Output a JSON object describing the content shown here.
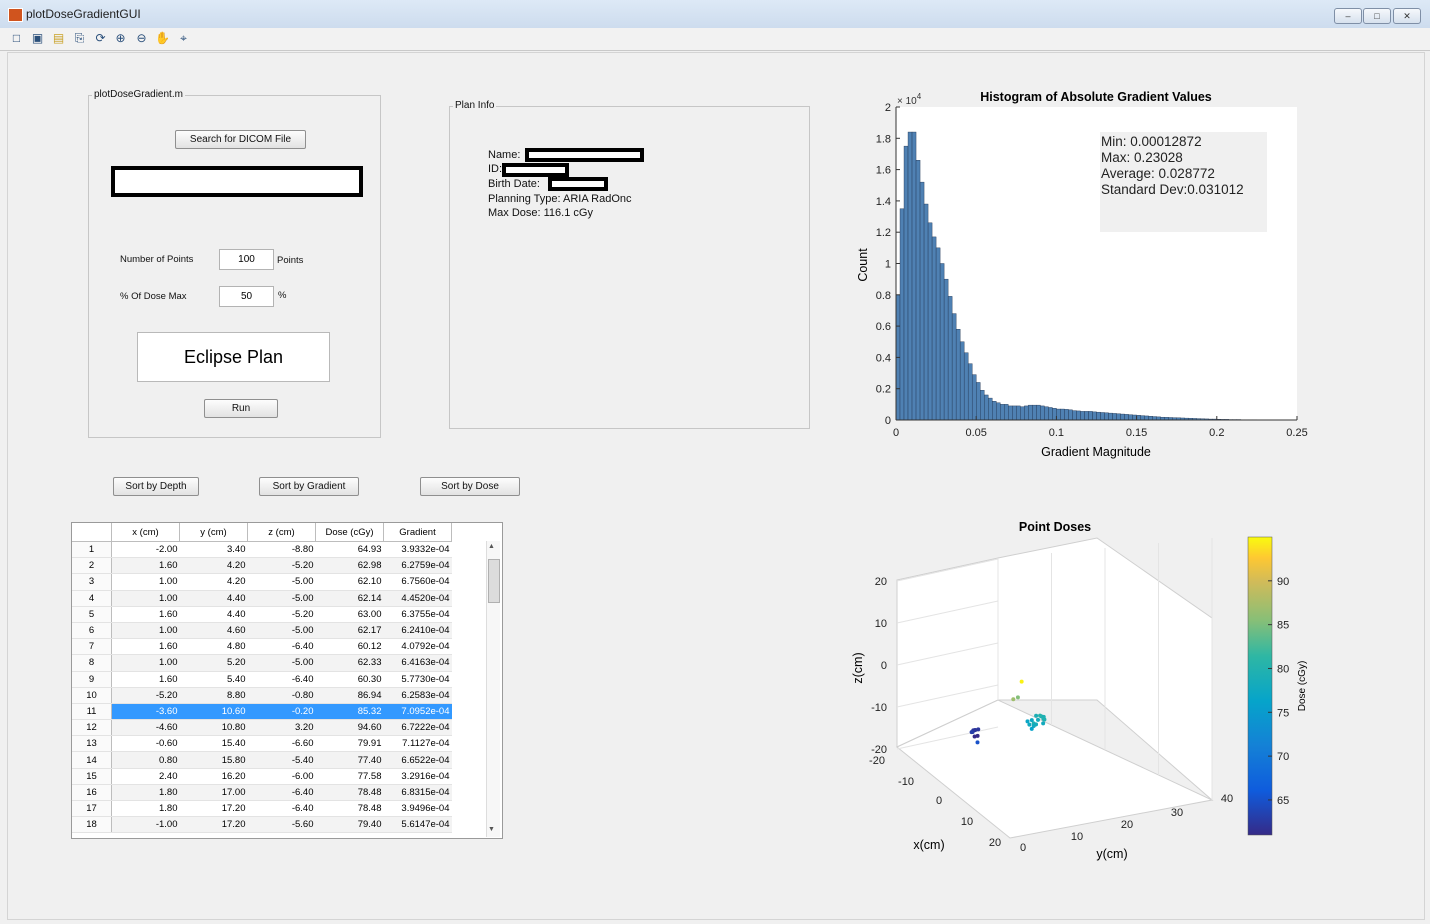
{
  "window": {
    "title": "plotDoseGradientGUI"
  },
  "toolbar": {
    "icons": [
      "new-icon",
      "save-icon",
      "open-icon",
      "print-icon",
      "rotate-icon",
      "zoom-in-icon",
      "zoom-out-icon",
      "pan-icon",
      "datacursor-icon"
    ]
  },
  "left_panel": {
    "title": "plotDoseGradient.m",
    "search_button": "Search for DICOM File",
    "num_points_label": "Number of Points",
    "num_points_value": "100",
    "num_points_unit": "Points",
    "dose_max_label": "% Of Dose Max",
    "dose_max_value": "50",
    "dose_max_unit": "%",
    "plan_type_display": "Eclipse Plan",
    "run_button": "Run"
  },
  "plan_info": {
    "title": "Plan Info",
    "name_label": "Name:",
    "id_label": "ID:",
    "birth_label": "Birth Date:",
    "planning_type": "Planning Type: ARIA RadOnc",
    "max_dose": "Max Dose: 116.1 cGy"
  },
  "sort_buttons": {
    "depth": "Sort by Depth",
    "gradient": "Sort by Gradient",
    "dose": "Sort by Dose"
  },
  "table": {
    "columns": [
      "x (cm)",
      "y (cm)",
      "z (cm)",
      "Dose (cGy)",
      "Gradient"
    ],
    "selected_row": 11,
    "rows": [
      [
        "1",
        "-2.00",
        "3.40",
        "-8.80",
        "64.93",
        "3.9332e-04"
      ],
      [
        "2",
        "1.60",
        "4.20",
        "-5.20",
        "62.98",
        "6.2759e-04"
      ],
      [
        "3",
        "1.00",
        "4.20",
        "-5.00",
        "62.10",
        "6.7560e-04"
      ],
      [
        "4",
        "1.00",
        "4.40",
        "-5.00",
        "62.14",
        "4.4520e-04"
      ],
      [
        "5",
        "1.60",
        "4.40",
        "-5.20",
        "63.00",
        "6.3755e-04"
      ],
      [
        "6",
        "1.00",
        "4.60",
        "-5.00",
        "62.17",
        "6.2410e-04"
      ],
      [
        "7",
        "1.60",
        "4.80",
        "-6.40",
        "60.12",
        "4.0792e-04"
      ],
      [
        "8",
        "1.00",
        "5.20",
        "-5.00",
        "62.33",
        "6.4163e-04"
      ],
      [
        "9",
        "1.60",
        "5.40",
        "-6.40",
        "60.30",
        "5.7730e-04"
      ],
      [
        "10",
        "-5.20",
        "8.80",
        "-0.80",
        "86.94",
        "6.2583e-04"
      ],
      [
        "11",
        "-3.60",
        "10.60",
        "-0.20",
        "85.32",
        "7.0952e-04"
      ],
      [
        "12",
        "-4.60",
        "10.80",
        "3.20",
        "94.60",
        "6.7222e-04"
      ],
      [
        "13",
        "-0.60",
        "15.40",
        "-6.60",
        "79.91",
        "7.1127e-04"
      ],
      [
        "14",
        "0.80",
        "15.80",
        "-5.40",
        "77.40",
        "6.6522e-04"
      ],
      [
        "15",
        "2.40",
        "16.20",
        "-6.00",
        "77.58",
        "3.2916e-04"
      ],
      [
        "16",
        "1.80",
        "17.00",
        "-6.40",
        "78.48",
        "6.8315e-04"
      ],
      [
        "17",
        "1.80",
        "17.20",
        "-6.40",
        "78.48",
        "3.9496e-04"
      ],
      [
        "18",
        "-1.00",
        "17.20",
        "-5.60",
        "79.40",
        "5.6147e-04"
      ]
    ]
  },
  "histogram": {
    "chart_data": {
      "type": "bar",
      "title": "Histogram of Absolute Gradient Values",
      "xlabel": "Gradient Magnitude",
      "ylabel": "Count",
      "y_exponent_label": "× 10",
      "y_exponent_power": "4",
      "xlim": [
        0,
        0.25
      ],
      "ylim": [
        0,
        2
      ],
      "xticks": [
        "0",
        "0.05",
        "0.1",
        "0.15",
        "0.2",
        "0.25"
      ],
      "yticks": [
        "0",
        "0.2",
        "0.4",
        "0.6",
        "0.8",
        "1",
        "1.2",
        "1.4",
        "1.6",
        "1.8",
        "2"
      ],
      "bin_width": 0.0025,
      "values": [
        0.8,
        1.35,
        1.75,
        1.84,
        1.84,
        1.66,
        1.52,
        1.38,
        1.26,
        1.17,
        1.1,
        1.0,
        0.9,
        0.79,
        0.68,
        0.58,
        0.5,
        0.43,
        0.36,
        0.29,
        0.24,
        0.19,
        0.16,
        0.14,
        0.12,
        0.11,
        0.1,
        0.1,
        0.09,
        0.09,
        0.09,
        0.085,
        0.09,
        0.095,
        0.095,
        0.095,
        0.09,
        0.085,
        0.08,
        0.075,
        0.07,
        0.07,
        0.068,
        0.065,
        0.06,
        0.058,
        0.055,
        0.055,
        0.055,
        0.052,
        0.05,
        0.048,
        0.046,
        0.044,
        0.042,
        0.04,
        0.038,
        0.036,
        0.034,
        0.032,
        0.03,
        0.028,
        0.026,
        0.024,
        0.022,
        0.02,
        0.018,
        0.017,
        0.016,
        0.015,
        0.014,
        0.013,
        0.012,
        0.011,
        0.01,
        0.009,
        0.008,
        0.007,
        0.006,
        0.006,
        0.005,
        0.004,
        0.004,
        0.003,
        0.003,
        0.003,
        0.002,
        0.002,
        0.002,
        0.002,
        0.001,
        0.001
      ]
    },
    "stats": {
      "min": "Min: 0.00012872",
      "max": "Max: 0.23028",
      "avg": "Average: 0.028772",
      "std": "Standard Dev:0.031012"
    }
  },
  "scatter3d": {
    "chart_data": {
      "type": "scatter",
      "title": "Point Doses",
      "xlabel": "x(cm)",
      "ylabel": "y(cm)",
      "zlabel": "z(cm)",
      "colorbar_label": "Dose (cGy)",
      "xticks": [
        "-20",
        "-10",
        "0",
        "10",
        "20"
      ],
      "yticks": [
        "0",
        "10",
        "20",
        "30",
        "40"
      ],
      "zticks": [
        "20",
        "10",
        "0",
        "-10",
        "-20"
      ],
      "colorbar_ticks": [
        "90",
        "85",
        "80",
        "75",
        "70",
        "65"
      ],
      "colorbar_range": [
        61,
        95
      ],
      "points": [
        {
          "x": -2.0,
          "y": 3.4,
          "z": -8.8,
          "d": 64.93
        },
        {
          "x": 1.6,
          "y": 4.2,
          "z": -5.2,
          "d": 62.98
        },
        {
          "x": 1.0,
          "y": 4.2,
          "z": -5.0,
          "d": 62.1
        },
        {
          "x": 1.0,
          "y": 4.4,
          "z": -5.0,
          "d": 62.14
        },
        {
          "x": 1.6,
          "y": 4.4,
          "z": -5.2,
          "d": 63.0
        },
        {
          "x": 1.0,
          "y": 4.6,
          "z": -5.0,
          "d": 62.17
        },
        {
          "x": 1.6,
          "y": 4.8,
          "z": -6.4,
          "d": 60.12
        },
        {
          "x": 1.0,
          "y": 5.2,
          "z": -5.0,
          "d": 62.33
        },
        {
          "x": 1.6,
          "y": 5.4,
          "z": -6.4,
          "d": 60.3
        },
        {
          "x": -5.2,
          "y": 8.8,
          "z": -0.8,
          "d": 86.94
        },
        {
          "x": -3.6,
          "y": 10.6,
          "z": -0.2,
          "d": 85.32
        },
        {
          "x": -4.6,
          "y": 10.8,
          "z": 3.2,
          "d": 94.6
        },
        {
          "x": -0.6,
          "y": 15.4,
          "z": -6.6,
          "d": 79.91
        },
        {
          "x": 0.8,
          "y": 15.8,
          "z": -5.4,
          "d": 77.4
        },
        {
          "x": 2.4,
          "y": 16.2,
          "z": -6.0,
          "d": 77.58
        },
        {
          "x": 1.8,
          "y": 17.0,
          "z": -6.4,
          "d": 78.48
        },
        {
          "x": 1.8,
          "y": 17.2,
          "z": -6.4,
          "d": 78.48
        },
        {
          "x": -1.0,
          "y": 17.2,
          "z": -5.6,
          "d": 79.4
        },
        {
          "x": 0.0,
          "y": 16.6,
          "z": -5.8,
          "d": 78.2
        },
        {
          "x": 1.2,
          "y": 16.4,
          "z": -6.8,
          "d": 77.9
        },
        {
          "x": -0.4,
          "y": 16.0,
          "z": -4.8,
          "d": 79.1
        },
        {
          "x": 2.0,
          "y": 15.6,
          "z": -5.2,
          "d": 76.8
        },
        {
          "x": 0.6,
          "y": 17.6,
          "z": -5.0,
          "d": 78.9
        },
        {
          "x": -1.6,
          "y": 16.8,
          "z": -6.2,
          "d": 80.1
        },
        {
          "x": 3.0,
          "y": 17.0,
          "z": -7.0,
          "d": 76.2
        },
        {
          "x": 0.2,
          "y": 18.0,
          "z": -6.0,
          "d": 79.6
        },
        {
          "x": -2.2,
          "y": 15.8,
          "z": -5.4,
          "d": 80.5
        },
        {
          "x": 1.4,
          "y": 18.4,
          "z": -6.6,
          "d": 78.0
        }
      ]
    }
  }
}
